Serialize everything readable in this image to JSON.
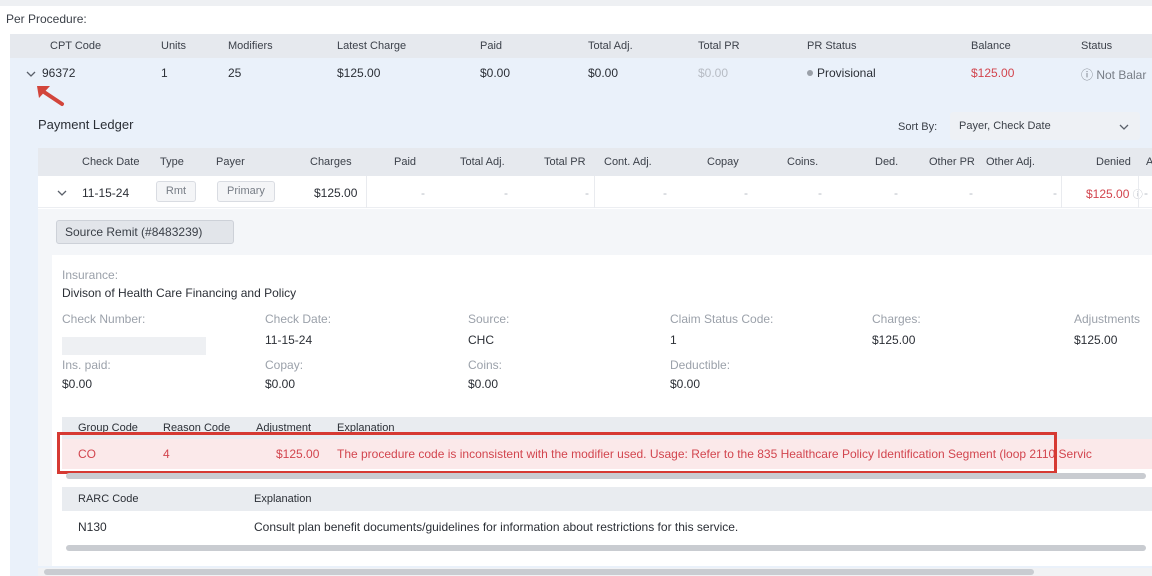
{
  "section_title": "Per Procedure:",
  "procedure_table": {
    "headers": [
      "CPT Code",
      "Units",
      "Modifiers",
      "Latest Charge",
      "Paid",
      "Total Adj.",
      "Total PR",
      "PR Status",
      "Balance",
      "Status"
    ],
    "row": {
      "cpt_code": "96372",
      "units": "1",
      "modifiers": "25",
      "latest_charge": "$125.00",
      "paid": "$0.00",
      "total_adj": "$0.00",
      "total_pr": "$0.00",
      "pr_status": "Provisional",
      "balance": "$125.00",
      "status": "ⓘ Not Balar"
    }
  },
  "ledger": {
    "title": "Payment Ledger",
    "sort_by_label": "Sort By:",
    "sort_by_value": "Payer, Check Date",
    "headers": [
      "Check Date",
      "Type",
      "Payer",
      "Charges",
      "Paid",
      "Total Adj.",
      "Total PR",
      "Cont. Adj.",
      "Copay",
      "Coins.",
      "Ded.",
      "Other PR",
      "Other Adj.",
      "Denied",
      "A"
    ],
    "row": {
      "check_date": "11-15-24",
      "type": "Rmt",
      "payer": "Primary",
      "charges": "$125.00",
      "paid": "-",
      "total_adj": "-",
      "total_pr": "-",
      "cont_adj": "-",
      "copay": "-",
      "coins": "-",
      "ded": "-",
      "other_pr": "-",
      "other_adj": "-",
      "denied": "$125.00",
      "extra": "-"
    }
  },
  "remit": {
    "tag": "Source Remit (#8483239)",
    "insurance_label": "Insurance:",
    "insurance_value": "Divison of Health Care Financing and Policy",
    "check_number_label": "Check Number:",
    "check_date_label": "Check Date:",
    "check_date_value": "11-15-24",
    "source_label": "Source:",
    "source_value": "CHC",
    "claim_status_label": "Claim Status Code:",
    "claim_status_value": "1",
    "charges_label": "Charges:",
    "charges_value": "$125.00",
    "adjustments_label": "Adjustments",
    "adjustments_value": "$125.00",
    "ins_paid_label": "Ins. paid:",
    "ins_paid_value": "$0.00",
    "copay_label": "Copay:",
    "copay_value": "$0.00",
    "coins_label": "Coins:",
    "coins_value": "$0.00",
    "deductible_label": "Deductible:",
    "deductible_value": "$0.00"
  },
  "adjustments": {
    "headers": [
      "Group Code",
      "Reason Code",
      "Adjustment",
      "Explanation"
    ],
    "row": {
      "group_code": "CO",
      "reason_code": "4",
      "adjustment": "$125.00",
      "explanation": "The procedure code is inconsistent with the modifier used. Usage: Refer to the 835 Healthcare Policy Identification Segment (loop 2110 Servic"
    }
  },
  "rarc": {
    "headers": [
      "RARC Code",
      "Explanation"
    ],
    "row": {
      "code": "N130",
      "explanation": "Consult plan benefit documents/guidelines for information about restrictions for this service."
    }
  },
  "colors": {
    "accent_red": "#d2454e",
    "highlight_box": "#d63a33",
    "panel_blue": "#eaf1fa"
  }
}
